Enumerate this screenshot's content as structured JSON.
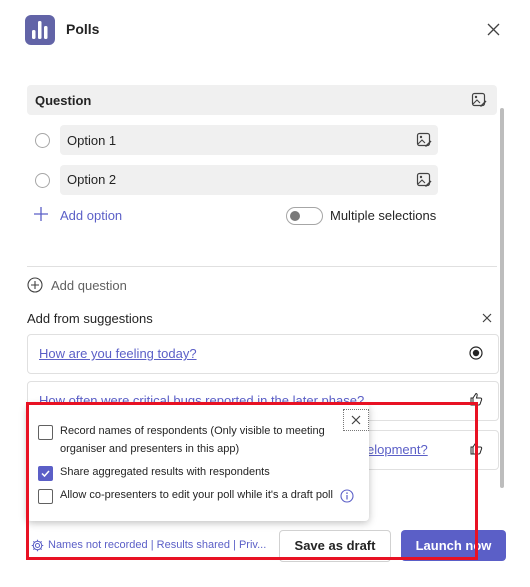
{
  "header": {
    "title": "Polls",
    "app_icon": "poll-bars-icon",
    "close_icon": "close-icon",
    "brand_color": "#6264A7"
  },
  "question": {
    "label": "Question",
    "edit_icon": "edit-image-icon"
  },
  "options": [
    {
      "label": "Option 1"
    },
    {
      "label": "Option 2"
    }
  ],
  "add_option": {
    "label": "Add option",
    "icon": "plus-icon"
  },
  "multiple_selections": {
    "label": "Multiple selections",
    "enabled": false
  },
  "add_question": {
    "label": "Add question",
    "icon": "circle-plus-icon"
  },
  "suggestions": {
    "title": "Add from suggestions",
    "items": [
      {
        "text": "How are you feeling today?",
        "icon": "radio-selected-icon"
      },
      {
        "text": "How often were critical bugs reported in the later phase?",
        "icon": "thumbs-up-icon"
      },
      {
        "text": "elopment?",
        "icon": "thumbs-up-icon"
      }
    ]
  },
  "settings_popup": {
    "items": [
      {
        "label": "Record names of respondents (Only visible to meeting organiser and presenters in this app)",
        "checked": false
      },
      {
        "label": "Share aggregated results with respondents",
        "checked": true
      },
      {
        "label": "Allow co-presenters to edit your poll while it's a draft poll",
        "checked": false
      }
    ],
    "info_icon": "info-icon"
  },
  "footer": {
    "status": "Names not recorded | Results shared | Priv...",
    "save_draft": "Save as draft",
    "launch": "Launch now"
  },
  "colors": {
    "accent": "#5b5fc7",
    "highlight": "#e81123"
  }
}
